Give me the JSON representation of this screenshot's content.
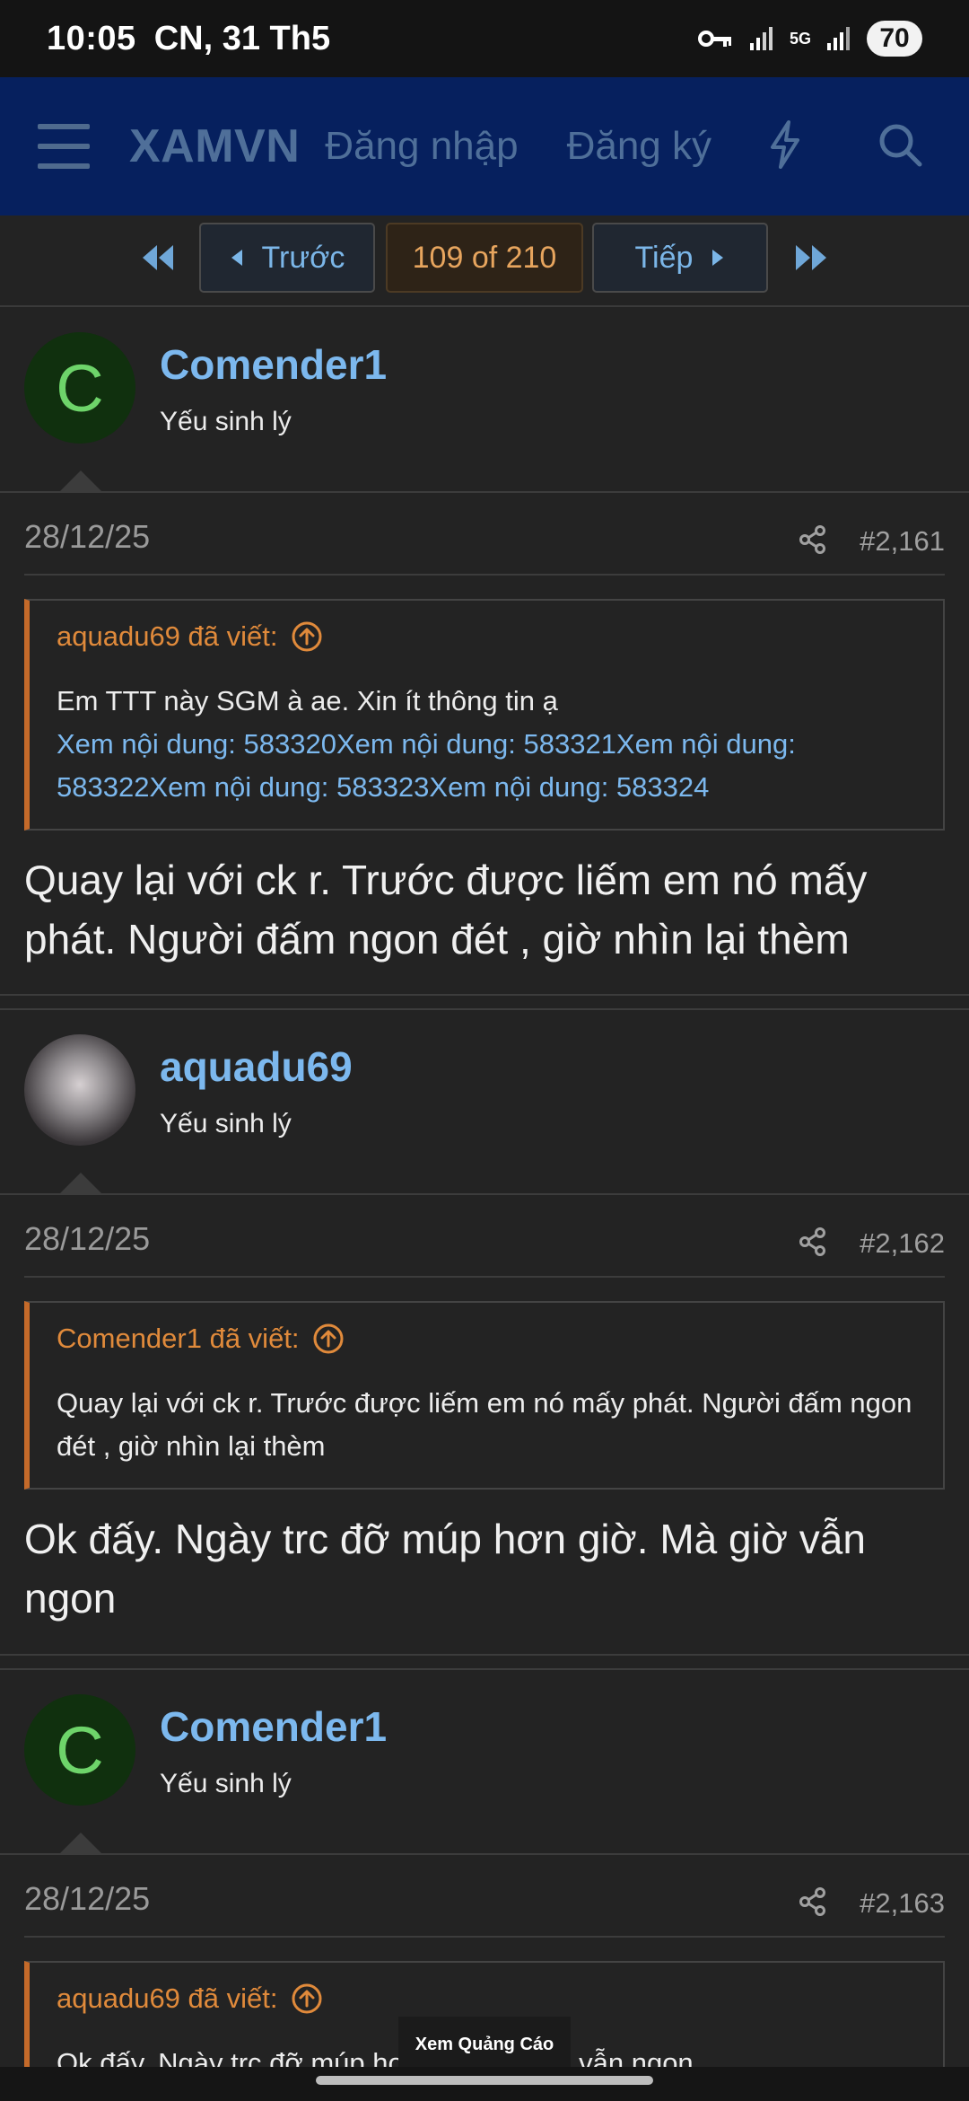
{
  "status_bar": {
    "time": "10:05",
    "date": "CN, 31 Th5",
    "network": "5G",
    "battery": "70",
    "icons": [
      "vpn-key-icon",
      "signal-icon",
      "5g-data-icon",
      "signal-icon-2"
    ]
  },
  "nav": {
    "logo": "XAMVN",
    "login": "Đăng nhập",
    "register": "Đăng ký",
    "icons": [
      "hamburger-menu-icon",
      "lightning-icon",
      "search-icon"
    ]
  },
  "pager": {
    "prev_label": "Trước",
    "current": "109 of 210",
    "next_label": "Tiếp"
  },
  "posts": [
    {
      "username": "Comender1",
      "avatar_letter": "C",
      "user_title": "Yếu sinh lý",
      "date": "28/12/25",
      "number": "#2,161",
      "quote": {
        "author_line": "aquadu69 đã viết:",
        "text": "Em TTT này SGM à ae. Xin ít thông tin ạ",
        "links": "Xem nội dung: 583320Xem nội dung: 583321Xem nội dung: 583322Xem nội dung: 583323Xem nội dung: 583324"
      },
      "message": "Quay lại với ck r. Trước được liếm em nó mấy phát. Người đấm ngon đét , giờ nhìn lại thèm"
    },
    {
      "username": "aquadu69",
      "user_title": "Yếu sinh lý",
      "date": "28/12/25",
      "number": "#2,162",
      "quote": {
        "author_line": "Comender1 đã viết:",
        "text": "Quay lại với ck r. Trước được liếm em nó mấy phát. Người đấm ngon đét , giờ nhìn lại thèm"
      },
      "message": "Ok đấy. Ngày trc đỡ múp hơn giờ. Mà giờ vẫn ngon"
    },
    {
      "username": "Comender1",
      "avatar_letter": "C",
      "user_title": "Yếu sinh lý",
      "date": "28/12/25",
      "number": "#2,163",
      "quote": {
        "author_line": "aquadu69 đã viết:",
        "text": "Ok đấy. Ngày trc đỡ múp hơn giờ. Mà giờ vẫn ngon"
      }
    }
  ],
  "ad": {
    "label": "Xem Quảng Cáo"
  },
  "colors": {
    "nav_bg": "#06205e",
    "link_blue": "#7cb8ee",
    "quote_orange": "#e08a3b",
    "page_bg": "#232323"
  }
}
